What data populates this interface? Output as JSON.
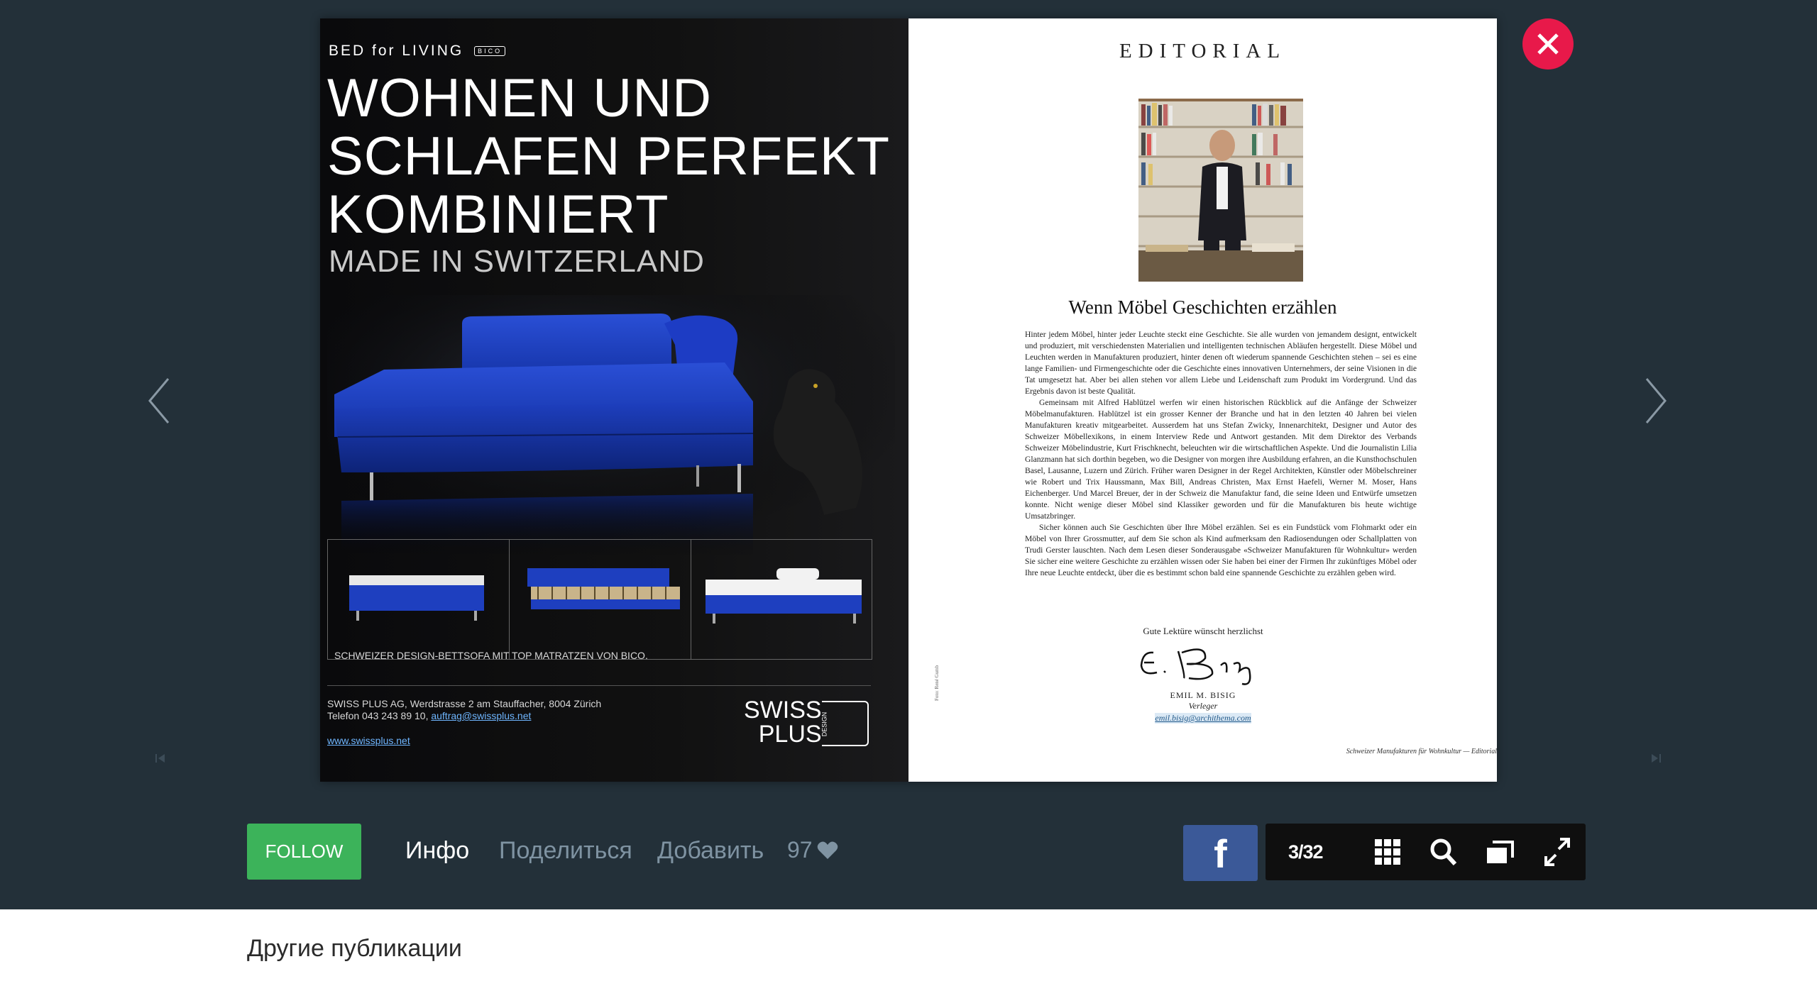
{
  "spread": {
    "left_page": {
      "logo": "BED for LIVING",
      "logo_badge": "BICO",
      "headline": [
        "WOHNEN UND",
        "SCHLAFEN PERFEKT",
        "KOMBINIERT"
      ],
      "subheadline": "MADE IN SWITZERLAND",
      "caption": "SCHWEIZER DESIGN-BETTSOFA MIT TOP MATRATZEN VON BICO.",
      "address_line1": "SWISS PLUS AG, Werdstrasse 2 am Stauffacher, 8004 Zürich",
      "address_line2_prefix": "Telefon 043 243 89 10, ",
      "email": "auftrag@swissplus.net",
      "website": "www.swissplus.net",
      "brand_line1": "SWISS",
      "brand_line2": "PLUS",
      "brand_design": "DESIGN"
    },
    "right_page": {
      "title": "EDITORIAL",
      "heading": "Wenn Möbel Geschichten erzählen",
      "paragraphs": [
        "Hinter jedem Möbel, hinter jeder Leuchte steckt eine Geschichte. Sie alle wurden von jemandem designt, entwickelt und produziert, mit verschiedensten Materialien und intelligenten technischen Abläufen hergestellt. Diese Möbel und Leuchten werden in Manufakturen produziert, hinter denen oft wiederum spannende Geschichten stehen – sei es eine lange Familien- und Firmengeschichte oder die Geschichte eines innovativen Unternehmers, der seine Visionen in die Tat umgesetzt hat. Aber bei allen stehen vor allem Liebe und Leidenschaft zum Produkt im Vordergrund. Und das Ergebnis davon ist beste Qualität.",
        "Gemeinsam mit Alfred Hablützel werfen wir einen historischen Rückblick auf die Anfänge der Schweizer Möbelmanufakturen. Hablützel ist ein grosser Kenner der Branche und hat in den letzten 40 Jahren bei vielen Manufakturen kreativ mitgearbeitet. Ausserdem hat uns Stefan Zwicky, Innenarchitekt, Designer und Autor des Schweizer Möbellexikons, in einem Interview Rede und Antwort gestanden. Mit dem Direktor des Verbands Schweizer Möbelindustrie, Kurt Frischknecht, beleuchten wir die wirtschaftlichen Aspekte. Und die Journalistin Lilia Glanzmann hat sich dorthin begeben, wo die Designer von morgen ihre Ausbildung erfahren, an die Kunsthochschulen Basel, Lausanne, Luzern und Zürich. Früher waren Designer in der Regel Architekten, Künstler oder Möbelschreiner wie Robert und Trix Haussmann, Max Bill, Andreas Christen, Max Ernst Haefeli, Werner M. Moser, Hans Eichenberger. Und Marcel Breuer, der in der Schweiz die Manufaktur fand, die seine Ideen und Entwürfe umsetzen konnte. Nicht wenige dieser Möbel sind Klassiker geworden und für die Manufakturen bis heute wichtige Umsatzbringer.",
        "Sicher können auch Sie Geschichten über Ihre Möbel erzählen. Sei es ein Fundstück vom Flohmarkt oder ein Möbel von Ihrer Grossmutter, auf dem Sie schon als Kind aufmerksam den Radiosendungen oder Schallplatten von Trudi Gerster lauschten. Nach dem Lesen dieser Sonderausgabe «Schweizer Manufakturen für Wohnkultur» werden Sie sicher eine weitere Geschichte zu erzählen wissen oder Sie haben bei einer der Firmen Ihr zukünftiges Möbel oder Ihre neue Leuchte entdeckt, über die es bestimmt schon bald eine spannende Geschichte zu erzählen geben wird."
      ],
      "greeting": "Gute Lektüre wünscht herzlichst",
      "signer_name": "EMIL M. BISIG",
      "signer_role": "Verleger",
      "signer_email": "emil.bisig@archithema.com",
      "photo_credit": "Foto: René Gumb",
      "footer": "Schweizer Manufakturen für Wohnkultur — Editorial"
    }
  },
  "controls": {
    "close_icon": "close-x-icon",
    "prev_icon": "chevron-left-icon",
    "next_icon": "chevron-right-icon"
  },
  "bottom_bar": {
    "follow_label": "FOLLOW",
    "info_label": "Инфо",
    "share_label": "Поделиться",
    "add_label": "Добавить",
    "likes_count": "97",
    "facebook_label": "f",
    "page_counter": "3/32"
  },
  "footer_section": {
    "title": "Другие публикации"
  },
  "colors": {
    "background": "#233039",
    "follow_green": "#3cb35a",
    "close_red": "#e8194a",
    "facebook_blue": "#3b5998",
    "toolbar_black": "#0f0f0f"
  }
}
